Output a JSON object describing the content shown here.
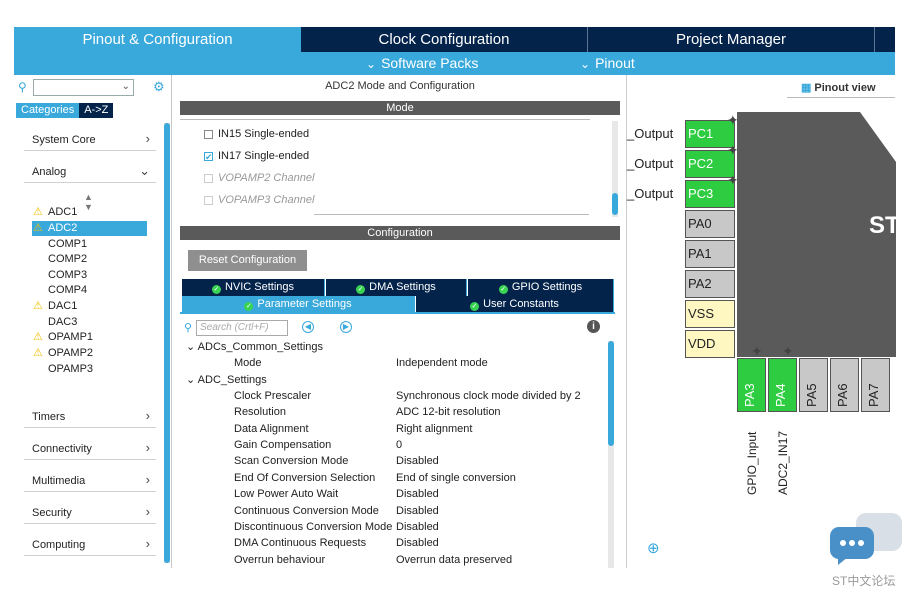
{
  "top_tabs": [
    {
      "label": "Pinout & Configuration",
      "active": true
    },
    {
      "label": "Clock Configuration",
      "active": false
    },
    {
      "label": "Project Manager",
      "active": false
    }
  ],
  "sub_bar": {
    "software_packs": "Software Packs",
    "pinout": "Pinout"
  },
  "left": {
    "category_tabs": [
      "Categories",
      "A->Z"
    ],
    "categories": {
      "system_core": "System Core",
      "analog": "Analog",
      "timers": "Timers",
      "connectivity": "Connectivity",
      "multimedia": "Multimedia",
      "security": "Security",
      "computing": "Computing"
    },
    "analog_items": [
      {
        "label": "ADC1",
        "warning": true,
        "selected": false
      },
      {
        "label": "ADC2",
        "warning": true,
        "selected": true
      },
      {
        "label": "COMP1",
        "warning": false,
        "selected": false
      },
      {
        "label": "COMP2",
        "warning": false,
        "selected": false
      },
      {
        "label": "COMP3",
        "warning": false,
        "selected": false
      },
      {
        "label": "COMP4",
        "warning": false,
        "selected": false
      },
      {
        "label": "DAC1",
        "warning": true,
        "selected": false
      },
      {
        "label": "DAC3",
        "warning": false,
        "selected": false
      },
      {
        "label": "OPAMP1",
        "warning": true,
        "selected": false
      },
      {
        "label": "OPAMP2",
        "warning": true,
        "selected": false
      },
      {
        "label": "OPAMP3",
        "warning": false,
        "selected": false
      }
    ]
  },
  "middle": {
    "title": "ADC2 Mode and Configuration",
    "mode_header": "Mode",
    "mode_items": [
      {
        "label": "IN15 Single-ended",
        "checked": false,
        "disabled": false
      },
      {
        "label": "IN17 Single-ended",
        "checked": true,
        "disabled": false
      },
      {
        "label": "VOPAMP2 Channel",
        "checked": false,
        "disabled": true
      },
      {
        "label": "VOPAMP3 Channel",
        "checked": false,
        "disabled": true
      }
    ],
    "config_header": "Configuration",
    "reset_button": "Reset Configuration",
    "tabs_row1": [
      "NVIC Settings",
      "DMA Settings",
      "GPIO Settings"
    ],
    "tabs_row2": [
      "Parameter Settings",
      "User Constants"
    ],
    "search_placeholder": "Search (Crtl+F)",
    "groups": {
      "common": "ADCs_Common_Settings",
      "adc": "ADC_Settings"
    },
    "common_params": [
      {
        "name": "Mode",
        "value": "Independent mode"
      }
    ],
    "adc_params": [
      {
        "name": "Clock Prescaler",
        "value": "Synchronous clock mode divided by 2"
      },
      {
        "name": "Resolution",
        "value": "ADC 12-bit resolution"
      },
      {
        "name": "Data Alignment",
        "value": "Right alignment"
      },
      {
        "name": "Gain Compensation",
        "value": "0"
      },
      {
        "name": "Scan Conversion Mode",
        "value": "Disabled"
      },
      {
        "name": "End Of Conversion Selection",
        "value": "End of single conversion"
      },
      {
        "name": "Low Power Auto Wait",
        "value": "Disabled"
      },
      {
        "name": "Continuous Conversion Mode",
        "value": "Disabled"
      },
      {
        "name": "Discontinuous Conversion Mode",
        "value": "Disabled"
      },
      {
        "name": "DMA Continuous Requests",
        "value": "Disabled"
      },
      {
        "name": "Overrun behaviour",
        "value": "Overrun data preserved"
      }
    ]
  },
  "right": {
    "pinout_view": "Pinout view",
    "chip_label": "ST",
    "left_pins": [
      {
        "label": "PC1",
        "signal": "_Output",
        "state": "green"
      },
      {
        "label": "PC2",
        "signal": "_Output",
        "state": "green"
      },
      {
        "label": "PC3",
        "signal": "_Output",
        "state": "green"
      },
      {
        "label": "PA0",
        "signal": "",
        "state": "grey"
      },
      {
        "label": "PA1",
        "signal": "",
        "state": "grey"
      },
      {
        "label": "PA2",
        "signal": "",
        "state": "grey"
      },
      {
        "label": "VSS",
        "signal": "",
        "state": "yellow"
      },
      {
        "label": "VDD",
        "signal": "",
        "state": "yellow"
      }
    ],
    "bottom_pins": [
      {
        "label": "PA3",
        "signal": "GPIO_Input",
        "state": "green"
      },
      {
        "label": "PA4",
        "signal": "ADC2_IN17",
        "state": "green"
      },
      {
        "label": "PA5",
        "signal": "",
        "state": "grey"
      },
      {
        "label": "PA6",
        "signal": "",
        "state": "grey"
      },
      {
        "label": "PA7",
        "signal": "",
        "state": "grey"
      }
    ]
  },
  "watermark": "ST中文论坛",
  "colors": {
    "navy": "#03234b",
    "accent": "#39a9dc",
    "pin_green": "#2ecc40",
    "warning": "#f0c000"
  }
}
